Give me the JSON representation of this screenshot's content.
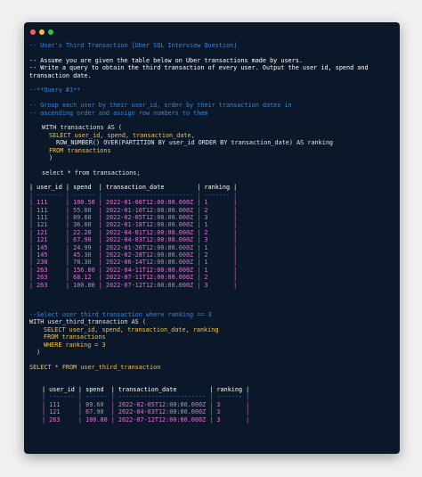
{
  "window": {
    "dots": [
      "red",
      "yellow",
      "green"
    ]
  },
  "lines": {
    "title": "-- User's Third Transaction [Uber SQL Interview Question]",
    "p1": "-- Assume you are given the table below on Uber transactions made by users.",
    "p2": "-- Write a query to obtain the third transaction of every user. Output the user id, spend and transaction date.",
    "q1": "--**Query #1**",
    "c1": "-- Group each user by their user_id, order by their transaction dates in",
    "c2": "-- ascending order and assign row numbers to them",
    "s1": "WITH transactions AS (",
    "s2": "SELECT user_id, spend, transaction_date,",
    "s3": "ROW_NUMBER() OVER(PARTITION BY user_id ORDER BY transaction_date) AS ranking",
    "s4": "FROM transactions",
    "s5": ")",
    "s6": "select * from transactions;",
    "t_head": "| user_id | spend  | transaction_date         | ranking |",
    "t_sep": "| ------- | ------ | ------------------------ | ------- |",
    "rows1": [
      "| 111     | 100.50 | 2022-01-08T12:00:00.000Z | 1       |",
      "| 111     | 55.00  | 2022-01-10T12:00:00.000Z | 2       |",
      "| 111     | 89.60  | 2022-02-05T12:00:00.000Z | 3       |",
      "| 121     | 36.00  | 2022-01-18T12:00:00.000Z | 1       |",
      "| 121     | 22.20  | 2022-04-01T12:00:00.000Z | 2       |",
      "| 121     | 67.90  | 2022-04-03T12:00:00.000Z | 3       |",
      "| 145     | 24.99  | 2022-01-26T12:00:00.000Z | 1       |",
      "| 145     | 45.30  | 2022-02-28T12:00:00.000Z | 2       |",
      "| 230     | 78.30  | 2022-06-14T12:00:00.000Z | 1       |",
      "| 263     | 156.00 | 2022-04-11T12:00:00.000Z | 1       |",
      "| 263     | 68.12  | 2022-07-11T12:00:00.000Z | 2       |",
      "| 263     | 100.00 | 2022-07-12T12:00:00.000Z | 3       |"
    ],
    "c3": "--Select user third transaction where ranking == 3",
    "u1": "WITH user_third_transaction AS (",
    "u2": "SELECT user_id, spend, transaction_date, ranking",
    "u3": "FROM transactions",
    "u4": "WHERE ranking = 3",
    "u5": ")",
    "u6": "SELECT * FROM user_third_transaction",
    "t2_head": "| user_id | spend  | transaction_date         | ranking |",
    "t2_sep": "| ------- | ------ | ------------------------ | ------- |",
    "rows2": [
      "| 111     | 89.60  | 2022-02-05T12:00:00.000Z | 3       |",
      "| 121     | 67.90  | 2022-04-03T12:00:00.000Z | 3       |",
      "| 263     | 100.00 | 2022-07-12T12:00:00.000Z | 3       |"
    ]
  }
}
